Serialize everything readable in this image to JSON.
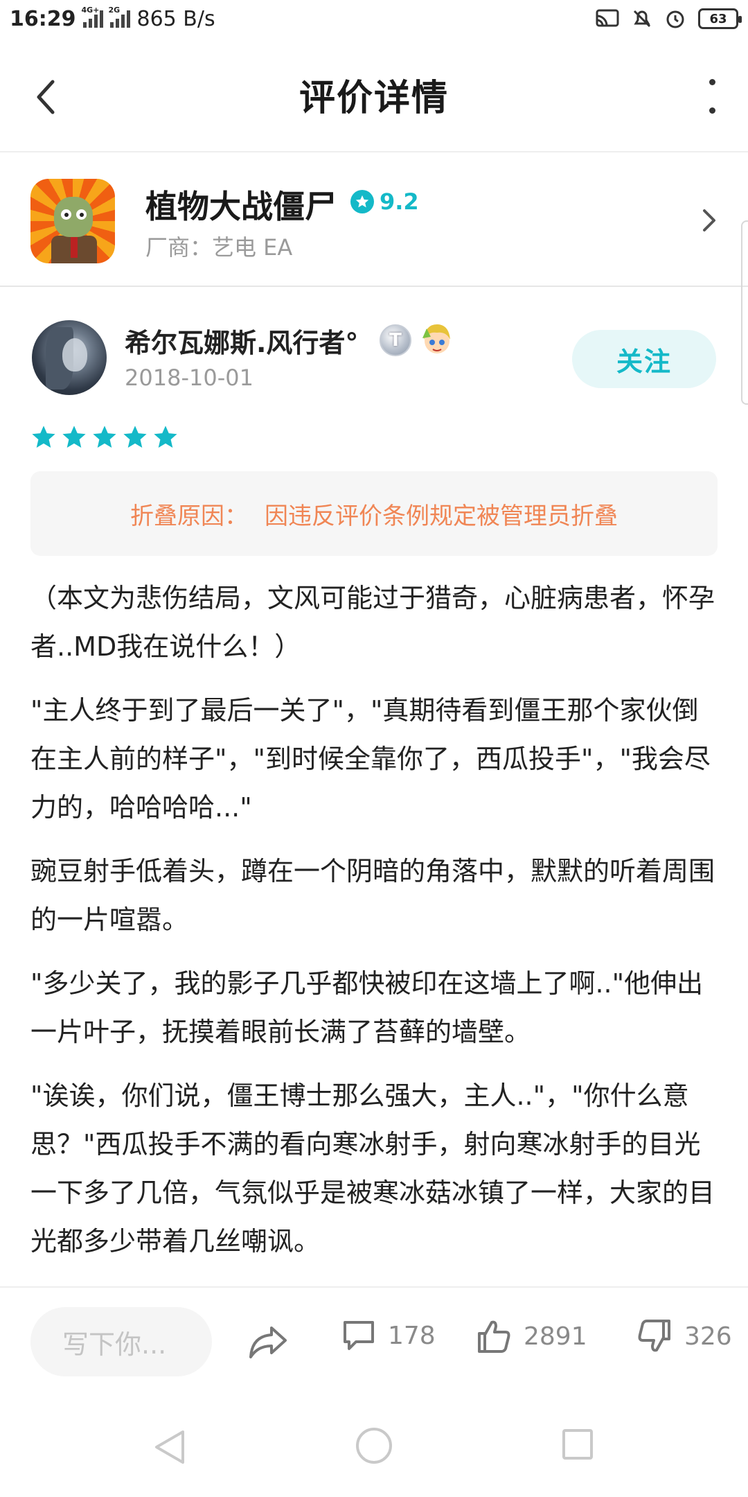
{
  "status_bar": {
    "time": "16:29",
    "network1": "4G+",
    "network2": "2G",
    "speed": "865 B/s",
    "battery": "63"
  },
  "header": {
    "title": "评价详情"
  },
  "app": {
    "name": "植物大战僵尸",
    "rating": "9.2",
    "vendor": "厂商：艺电 EA"
  },
  "review": {
    "username": "希尔瓦娜斯.风行者°",
    "badge_letter": "T",
    "date": "2018-10-01",
    "follow_label": "关注",
    "stars": 5,
    "fold_label": "折叠原因：",
    "fold_reason": "因违反评价条例规定被管理员折叠",
    "paragraphs": [
      "（本文为悲伤结局，文风可能过于猎奇，心脏病患者，怀孕者..MD我在说什么！）",
      "\"主人终于到了最后一关了\"，\"真期待看到僵王那个家伙倒在主人前的样子\"，\"到时候全靠你了，西瓜投手\"，\"我会尽力的，哈哈哈哈...\"",
      "豌豆射手低着头，蹲在一个阴暗的角落中，默默的听着周围的一片喧嚣。",
      "\"多少关了，我的影子几乎都快被印在这墙上了啊..\"他伸出一片叶子，抚摸着眼前长满了苔藓的墙壁。",
      "\"诶诶，你们说，僵王博士那么强大，主人..\"，\"你什么意思？\"西瓜投手不满的看向寒冰射手，射向寒冰射手的目光一下多了几倍，气氛似乎是被寒冰菇冰镇了一样，大家的目光都多少带着几丝嘲讽。"
    ]
  },
  "bottom_bar": {
    "input_placeholder": "写下你...",
    "comments": "178",
    "likes": "2891",
    "dislikes": "326"
  },
  "colors": {
    "accent": "#14b9c8",
    "fold_text": "#f08655"
  }
}
